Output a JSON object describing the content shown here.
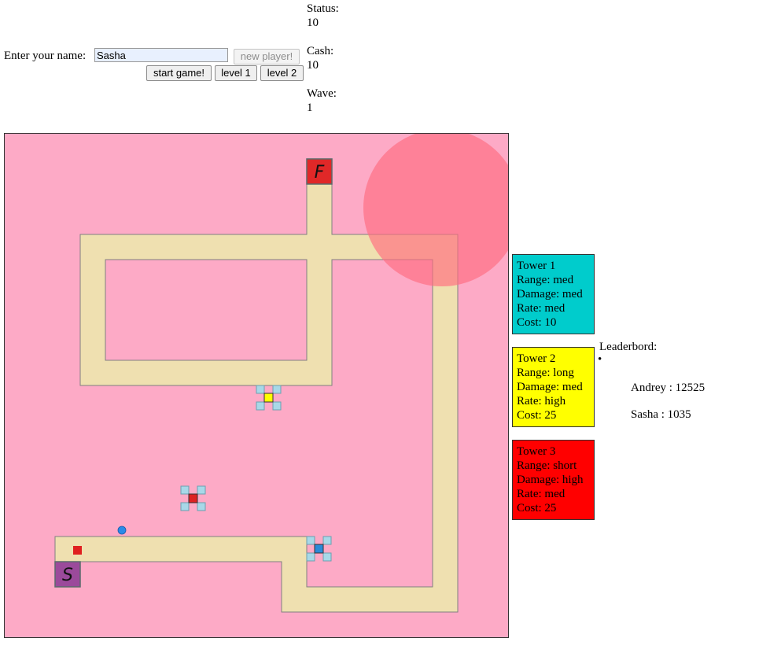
{
  "form": {
    "name_label": "Enter your name:",
    "name_value": "Sasha",
    "new_player_label": "new player!",
    "start_game_label": "start game!",
    "level1_label": "level 1",
    "level2_label": "level 2"
  },
  "stats": {
    "status_label": "Status:",
    "status_value": "10",
    "cash_label": "Cash:",
    "cash_value": "10",
    "wave_label": "Wave:",
    "wave_value": "1"
  },
  "board": {
    "background_color": "#fdaac6",
    "path_color": "#efe0b0",
    "start_label": "S",
    "finish_label": "F",
    "start_color": "#9b4a9b",
    "finish_color": "#e02828",
    "range_circle_color": "#ff6b7f"
  },
  "towers": [
    {
      "line1": "Tower 1",
      "line2": "Range: med",
      "line3": "Damage: med",
      "line4": "Rate: med",
      "line5": "Cost: 10",
      "color": "#00cccc"
    },
    {
      "line1": "Tower 2",
      "line2": "Range: long",
      "line3": "Damage: med",
      "line4": "Rate: high",
      "line5": "Cost: 25",
      "color": "#ffff00"
    },
    {
      "line1": "Tower 3",
      "line2": "Range: short",
      "line3": "Damage: high",
      "line4": "Rate: med",
      "line5": "Cost: 25",
      "color": "#ff0000"
    }
  ],
  "leaderboard": {
    "title": "Leaderbord:",
    "bullet": "•",
    "entries": [
      {
        "text": "Andrey : 12525"
      },
      {
        "text": "Sasha : 1035"
      }
    ]
  }
}
